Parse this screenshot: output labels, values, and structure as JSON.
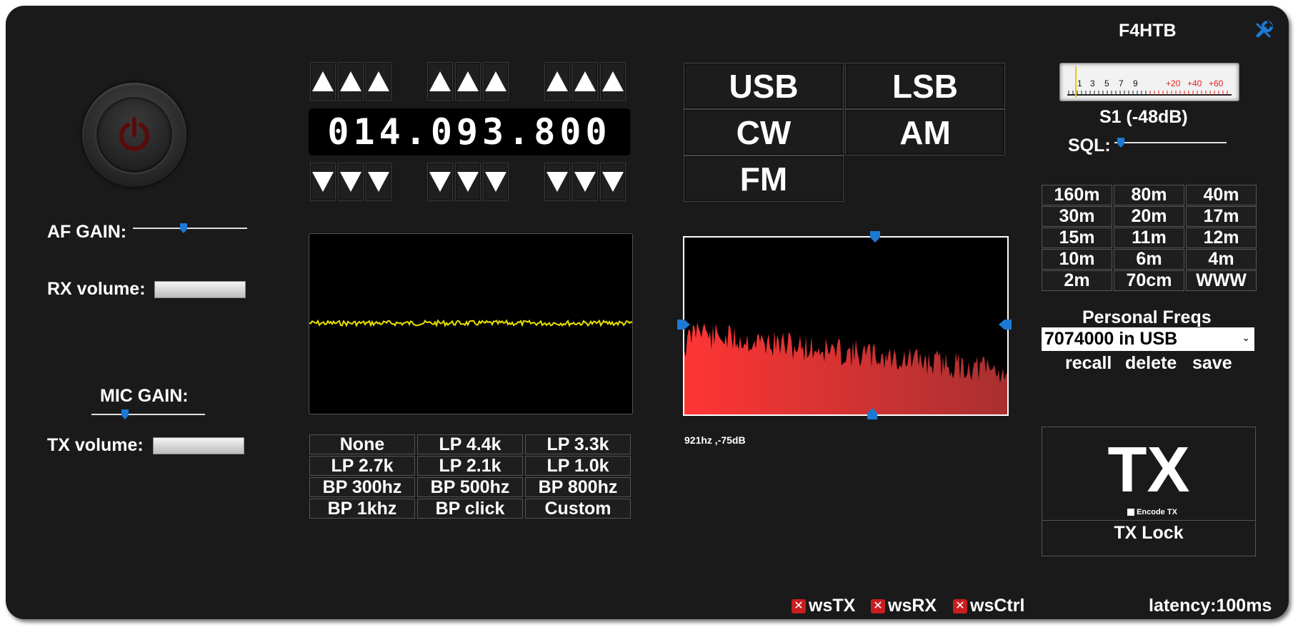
{
  "callsign": "F4HTB",
  "frequency": "014.093.800",
  "left": {
    "af_gain_label": "AF GAIN:",
    "rx_volume_label": "RX volume:",
    "mic_gain_label": "MIC GAIN:",
    "tx_volume_label": "TX volume:"
  },
  "modes": [
    "USB",
    "LSB",
    "CW",
    "AM",
    "FM"
  ],
  "filters": [
    "None",
    "LP 4.4k",
    "LP 3.3k",
    "LP 2.7k",
    "LP 2.1k",
    "LP 1.0k",
    "BP 300hz",
    "BP 500hz",
    "BP 800hz",
    "BP 1khz",
    "BP click",
    "Custom"
  ],
  "spectrum_readout": "921hz ,-75dB",
  "smeter": {
    "scale": [
      "1",
      "3",
      "5",
      "7",
      "9",
      "+20",
      "+40",
      "+60"
    ],
    "reading": "S1 (-48dB)"
  },
  "squelch_label": "SQL:",
  "bands": [
    "160m",
    "80m",
    "40m",
    "30m",
    "20m",
    "17m",
    "15m",
    "11m",
    "12m",
    "10m",
    "6m",
    "4m",
    "2m",
    "70cm",
    "WWW"
  ],
  "personal_freqs": {
    "title": "Personal Freqs",
    "selected": "7074000 in USB",
    "recall": "recall",
    "delete": "delete",
    "save": "save"
  },
  "tx": {
    "label": "TX",
    "encode_label": "Encode TX",
    "lock_label": "TX Lock"
  },
  "status": {
    "ws_tx": "wsTX",
    "ws_rx": "wsRX",
    "ws_ctrl": "wsCtrl",
    "latency": "latency:100ms"
  },
  "colors": {
    "background": "#1a1a1a",
    "accent_blue": "#1c7ad4",
    "scope_trace": "#e8e000",
    "spectrum": "#ff3030",
    "error_red": "#c91d22"
  }
}
